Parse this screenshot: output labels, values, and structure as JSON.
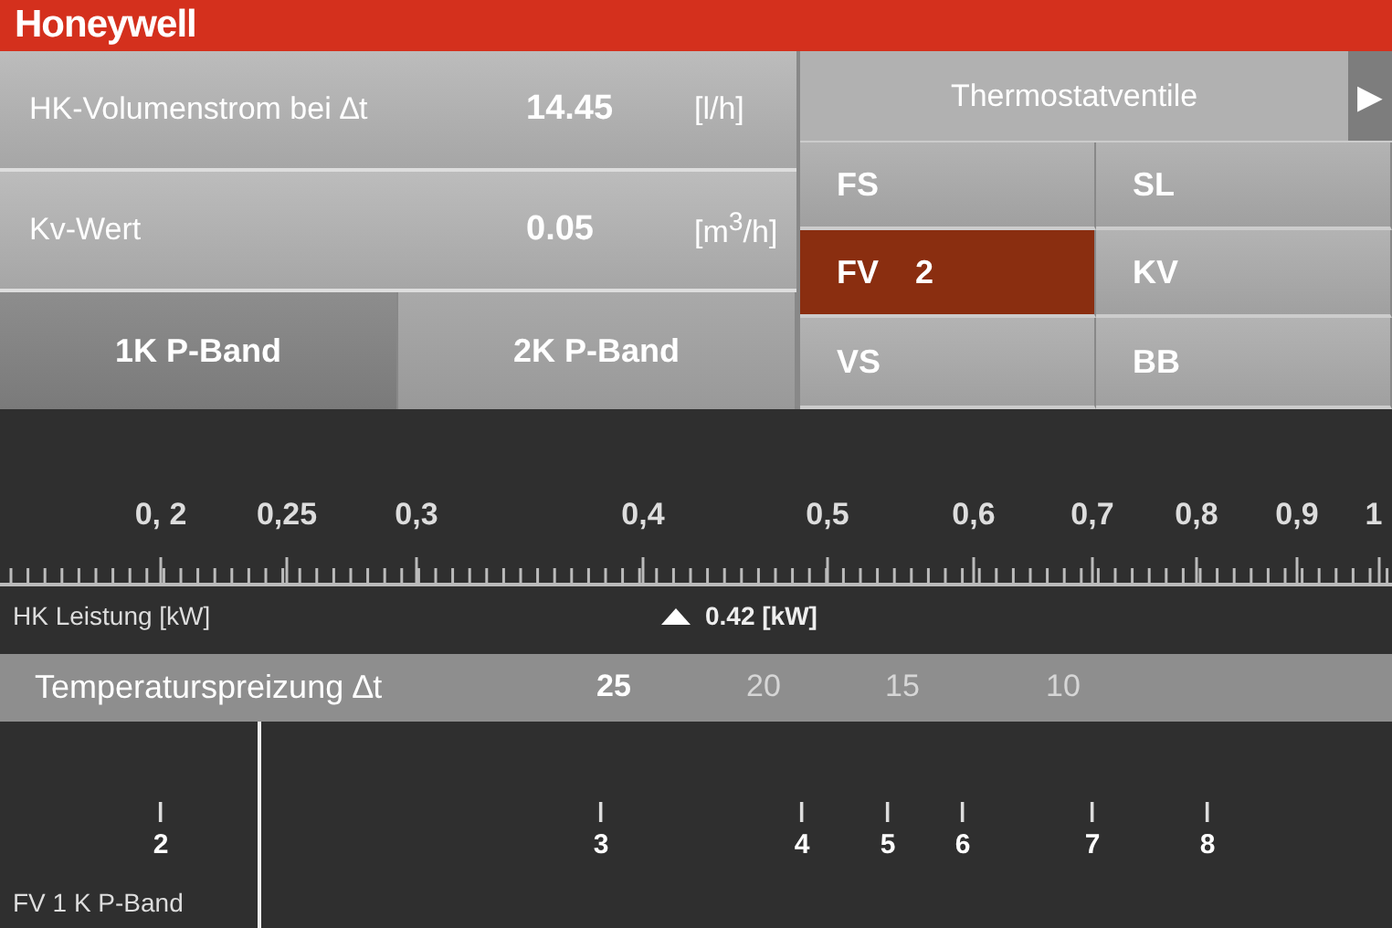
{
  "header": {
    "logo": "Honeywell"
  },
  "readings": [
    {
      "label": "HK-Volumenstrom bei ∆t",
      "value": "14.45",
      "unit": "[l/h]"
    },
    {
      "label": "Kv-Wert",
      "value": "0.05",
      "unit": "[m$^{3}$/h]"
    }
  ],
  "band_tabs": [
    {
      "label": "1K  P-Band",
      "selected": true
    },
    {
      "label": "2K  P-Band",
      "selected": false
    }
  ],
  "valve_panel": {
    "title": "Thermostatventile",
    "next": "▶"
  },
  "valve_types": [
    {
      "label": "FS",
      "selected": false
    },
    {
      "label": "SL",
      "selected": false
    },
    {
      "label": "FV",
      "value": "2",
      "selected": true
    },
    {
      "label": "KV",
      "selected": false
    },
    {
      "label": "VS",
      "selected": false
    },
    {
      "label": "BB",
      "selected": false
    }
  ],
  "power_scale": {
    "labels": [
      "0, 2",
      "0,25",
      "0,3",
      "0,4",
      "0,5",
      "0,6",
      "0,7",
      "0,8",
      "0,9",
      "1"
    ],
    "caption": "HK Leistung [kW]",
    "marker": "0.42 [kW]"
  },
  "spread": {
    "label": "Temperaturspreizung ∆t",
    "values": [
      {
        "text": "25",
        "selected": true
      },
      {
        "text": "20",
        "selected": false
      },
      {
        "text": "15",
        "selected": false
      },
      {
        "text": "10",
        "selected": false
      }
    ]
  },
  "presetting": {
    "labels": [
      "2",
      "3",
      "4",
      "5",
      "6",
      "7",
      "8"
    ],
    "caption": "FV 1 K P-Band"
  }
}
